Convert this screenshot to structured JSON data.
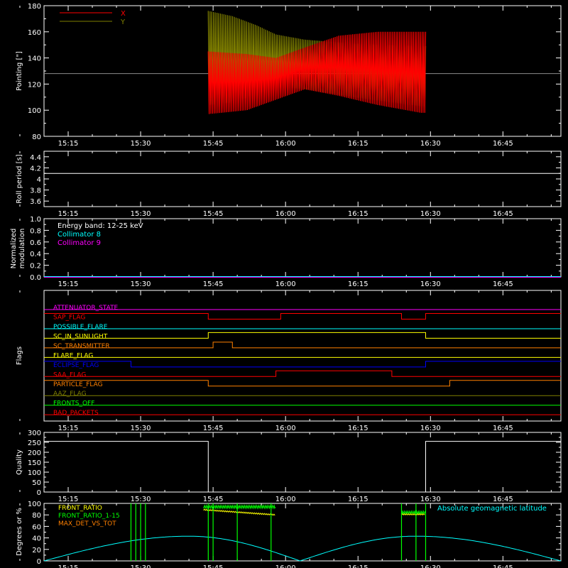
{
  "chart_data": [
    {
      "type": "line",
      "ylabel": "Pointing [\"]",
      "xlim": [
        "15:10",
        "16:57"
      ],
      "ylim": [
        80,
        180
      ],
      "yticks": [
        80,
        100,
        120,
        140,
        160,
        180
      ],
      "xtick_labels": [
        "15:15",
        "15:30",
        "15:45",
        "16:00",
        "16:15",
        "16:30",
        "16:45"
      ],
      "reference_line": 128,
      "series": [
        {
          "name": "X",
          "color": "#ff0000",
          "x_start": "15:44",
          "x_end": "16:29",
          "upper": [
            [
              0,
              145
            ],
            [
              8,
              143
            ],
            [
              14,
              140
            ],
            [
              20,
              148
            ],
            [
              27,
              157
            ],
            [
              35,
              160
            ],
            [
              44,
              160
            ]
          ],
          "lower": [
            [
              0,
              97
            ],
            [
              8,
              100
            ],
            [
              14,
              108
            ],
            [
              20,
              116
            ],
            [
              27,
              111
            ],
            [
              35,
              104
            ],
            [
              44,
              98
            ]
          ]
        },
        {
          "name": "Y",
          "color": "#808000",
          "x_start": "15:44",
          "x_end": "16:29",
          "upper": [
            [
              0,
              176
            ],
            [
              5,
              172
            ],
            [
              10,
              165
            ],
            [
              14,
              158
            ],
            [
              20,
              154
            ],
            [
              30,
              151
            ],
            [
              44,
              149
            ]
          ],
          "lower": [
            [
              0,
              104
            ],
            [
              5,
              106
            ],
            [
              10,
              112
            ],
            [
              14,
              118
            ],
            [
              20,
              116
            ],
            [
              30,
              110
            ],
            [
              44,
              103
            ]
          ]
        }
      ]
    },
    {
      "type": "line",
      "ylabel": "Roll period [s]",
      "ylim": [
        3.5,
        4.5
      ],
      "yticks": [
        3.6,
        3.8,
        4.0,
        4.2,
        4.4
      ],
      "xtick_labels": [
        "15:15",
        "15:30",
        "15:45",
        "16:00",
        "16:15",
        "16:30",
        "16:45"
      ],
      "series": [
        {
          "color": "#ffffff",
          "constant": 4.1
        }
      ]
    },
    {
      "type": "line",
      "ylabel": [
        "Normalized",
        "modulation"
      ],
      "ylim": [
        0,
        1
      ],
      "yticks": [
        "0.0",
        "0.2",
        "0.4",
        "0.6",
        "0.8",
        "1.0"
      ],
      "xtick_labels": [
        "15:15",
        "15:30",
        "15:45",
        "16:00",
        "16:15",
        "16:30",
        "16:45"
      ],
      "annotations": [
        "Energy band: 12-25 keV"
      ],
      "series": [
        {
          "name": "Collimator 8",
          "color": "#00ffff",
          "constant": 0
        },
        {
          "name": "Collimator 9",
          "color": "#ff00ff",
          "constant": 0
        }
      ]
    },
    {
      "type": "line",
      "ylabel": "Flags",
      "xtick_labels": [
        "15:15",
        "15:30",
        "15:45",
        "16:00",
        "16:15",
        "16:30",
        "16:45"
      ],
      "flags": [
        {
          "name": "ATTENUATOR_STATE",
          "color": "#ff00ff",
          "steps": [
            [
              "15:10",
              0
            ]
          ]
        },
        {
          "name": "SAP_FLAG",
          "color": "#ff0000",
          "steps": [
            [
              "15:10",
              1
            ],
            [
              "15:44",
              0
            ],
            [
              "15:59",
              1
            ],
            [
              "16:24",
              0
            ],
            [
              "16:29",
              1
            ]
          ]
        },
        {
          "name": "POSSIBLE_FLARE",
          "color": "#00ffff",
          "steps": [
            [
              "15:10",
              0
            ]
          ]
        },
        {
          "name": "SC_IN_SUNLIGHT",
          "color": "#ffff00",
          "steps": [
            [
              "15:10",
              0
            ],
            [
              "15:44",
              1
            ],
            [
              "16:29",
              0
            ]
          ]
        },
        {
          "name": "SC_TRANSMITTER",
          "color": "#ff8000",
          "steps": [
            [
              "15:10",
              0
            ],
            [
              "15:45",
              1
            ],
            [
              "15:49",
              0
            ]
          ]
        },
        {
          "name": "FLARE_FLAG",
          "color": "#ffff00",
          "steps": [
            [
              "15:10",
              0
            ]
          ]
        },
        {
          "name": "ECLIPSE_FLAG",
          "color": "#0000ff",
          "steps": [
            [
              "15:10",
              1
            ],
            [
              "15:28",
              0
            ],
            [
              "16:29",
              1
            ]
          ]
        },
        {
          "name": "SAA_FLAG",
          "color": "#ff0000",
          "steps": [
            [
              "15:10",
              0
            ],
            [
              "15:58",
              1
            ],
            [
              "16:22",
              0
            ]
          ]
        },
        {
          "name": "PARTICLE_FLAG",
          "color": "#ff8000",
          "steps": [
            [
              "15:10",
              1
            ],
            [
              "15:44",
              0
            ],
            [
              "16:34",
              1
            ]
          ]
        },
        {
          "name": "AAZ_FLAG",
          "color": "#808000",
          "steps": [
            [
              "15:10",
              0
            ]
          ]
        },
        {
          "name": "FRONTS_OFF",
          "color": "#00ff00",
          "steps": [
            [
              "15:10",
              0
            ]
          ]
        },
        {
          "name": "BAD_PACKETS",
          "color": "#ff0000",
          "steps": [
            [
              "15:10",
              0
            ]
          ]
        }
      ]
    },
    {
      "type": "line",
      "ylabel": "Quality",
      "ylim": [
        0,
        300
      ],
      "yticks": [
        0,
        50,
        100,
        150,
        200,
        250,
        300
      ],
      "xtick_labels": [
        "15:15",
        "15:30",
        "15:45",
        "16:00",
        "16:15",
        "16:30",
        "16:45"
      ],
      "series": [
        {
          "color": "#ffffff",
          "steps": [
            [
              "15:10",
              255
            ],
            [
              "15:44",
              0
            ],
            [
              "16:29",
              255
            ]
          ]
        }
      ]
    },
    {
      "type": "line",
      "ylabel": "Degrees or %",
      "ylim": [
        0,
        100
      ],
      "yticks": [
        0,
        20,
        40,
        60,
        80,
        100
      ],
      "xtick_labels": [
        "15:15",
        "15:30",
        "15:45",
        "16:00",
        "16:15",
        "16:30",
        "16:45"
      ],
      "legend": [
        "FRONT_RATIO",
        "FRONT_RATIO_1-15",
        "MAX_DET_VS_TOT"
      ],
      "series": [
        {
          "name": "FRONT_RATIO",
          "color": "#ffff00"
        },
        {
          "name": "FRONT_RATIO_1-15",
          "color": "#00ff00"
        },
        {
          "name": "MAX_DET_VS_TOT",
          "color": "#ff8000"
        },
        {
          "name": "Absolute geomagnetic latitude",
          "color": "#00ffff",
          "points": [
            [
              "15:10",
              0
            ],
            [
              "15:40",
              43
            ],
            [
              "16:03",
              0
            ],
            [
              "16:27",
              43
            ],
            [
              "16:57",
              0
            ]
          ]
        }
      ]
    }
  ]
}
